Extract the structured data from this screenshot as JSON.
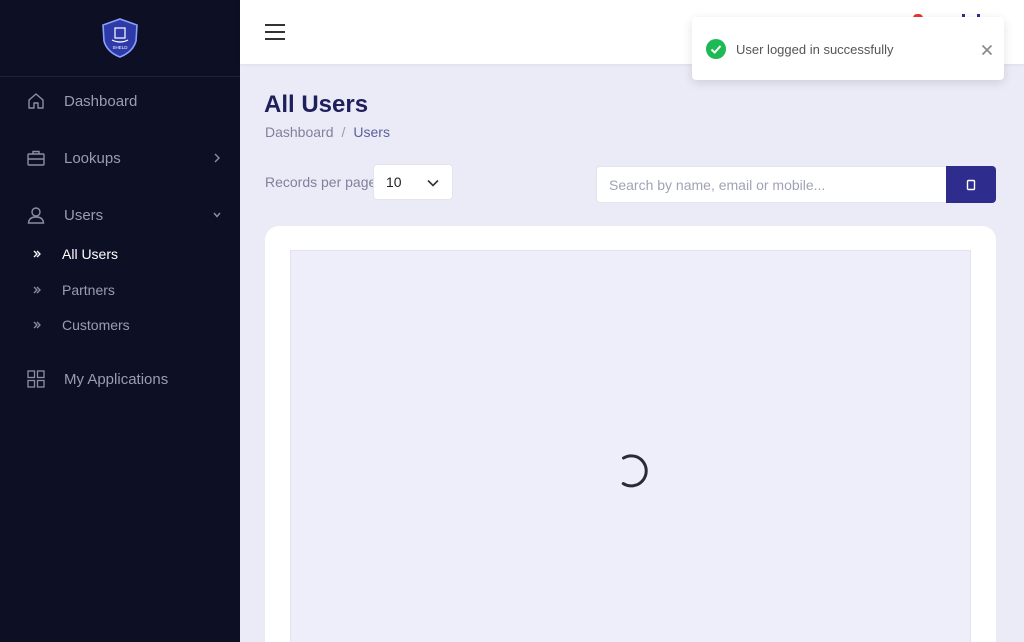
{
  "sidebar": {
    "logo_text": "SHELD",
    "items": [
      {
        "label": "Dashboard"
      },
      {
        "label": "Lookups"
      },
      {
        "label": "Users"
      },
      {
        "label": "My Applications"
      }
    ],
    "sub_items": [
      {
        "label": "All Users",
        "active": true
      },
      {
        "label": "Partners"
      },
      {
        "label": "Customers"
      }
    ]
  },
  "main": {
    "title": "All Users",
    "breadcrumb": [
      "Dashboard",
      "Users"
    ],
    "records_per_page_label": "Records per page",
    "records_per_page_value": "10",
    "search": {
      "placeholder": "Search by name, email or mobile..."
    }
  },
  "toast": {
    "message": "User logged in successfully"
  },
  "colors": {
    "sidebar_bg": "#0d0f24",
    "accent": "#2e2c8c",
    "success": "#1db954",
    "page_bg": "#ebebf7"
  }
}
